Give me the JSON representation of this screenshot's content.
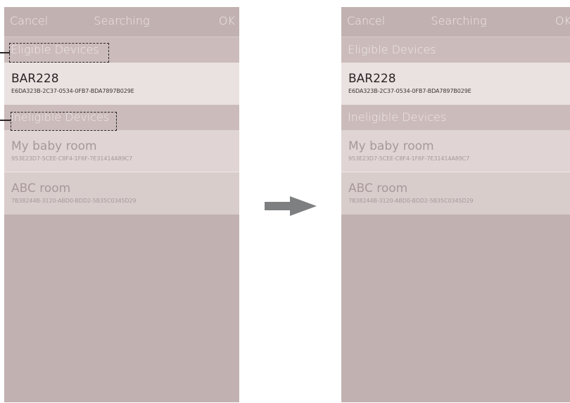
{
  "before": {
    "navbar": {
      "cancel_label": "Cancel",
      "title": "Searching",
      "ok_label": "OK"
    },
    "sections": {
      "eligible_header": "Eligible Devices",
      "ineligible_header": "Ineligible Devices"
    },
    "eligible_devices": [
      {
        "name": "BAR228",
        "uuid": "E6DA323B-2C37-0534-0FB7-BDA7897B029E"
      }
    ],
    "ineligible_devices": [
      {
        "name": "My baby room",
        "uuid": "953E23D7-5CEE-C8F4-1F6F-7E31414A89C7"
      },
      {
        "name": "ABC room",
        "uuid": "7B38244B-3120-ABD0-BDD2-5B35C0345D29"
      }
    ]
  },
  "after": {
    "navbar": {
      "cancel_label": "Cancel",
      "title": "Searching",
      "ok_label": "OK"
    },
    "sections": {
      "eligible_header": "Eligible Devices",
      "ineligible_header": "Ineligible Devices"
    },
    "eligible_devices": [
      {
        "name": "BAR228",
        "uuid": "E6DA323B-2C37-0534-0FB7-BDA7897B029E"
      }
    ],
    "ineligible_devices": [
      {
        "name": "My baby room",
        "uuid": "953E23D7-5CEE-C8F4-1F6F-7E31414A89C7"
      },
      {
        "name": "ABC room",
        "uuid": "7B38244B-3120-ABD0-BDD2-5B35C0345D29"
      }
    ]
  },
  "colors": {
    "background": "#c1b2b1",
    "section_header": "#cbbcbb",
    "eligible_row": "#eae2e1",
    "ineligible_row": "#e0d5d4",
    "arrow": "#7d7f80"
  },
  "icons": {
    "transition": "right-arrow-icon"
  }
}
